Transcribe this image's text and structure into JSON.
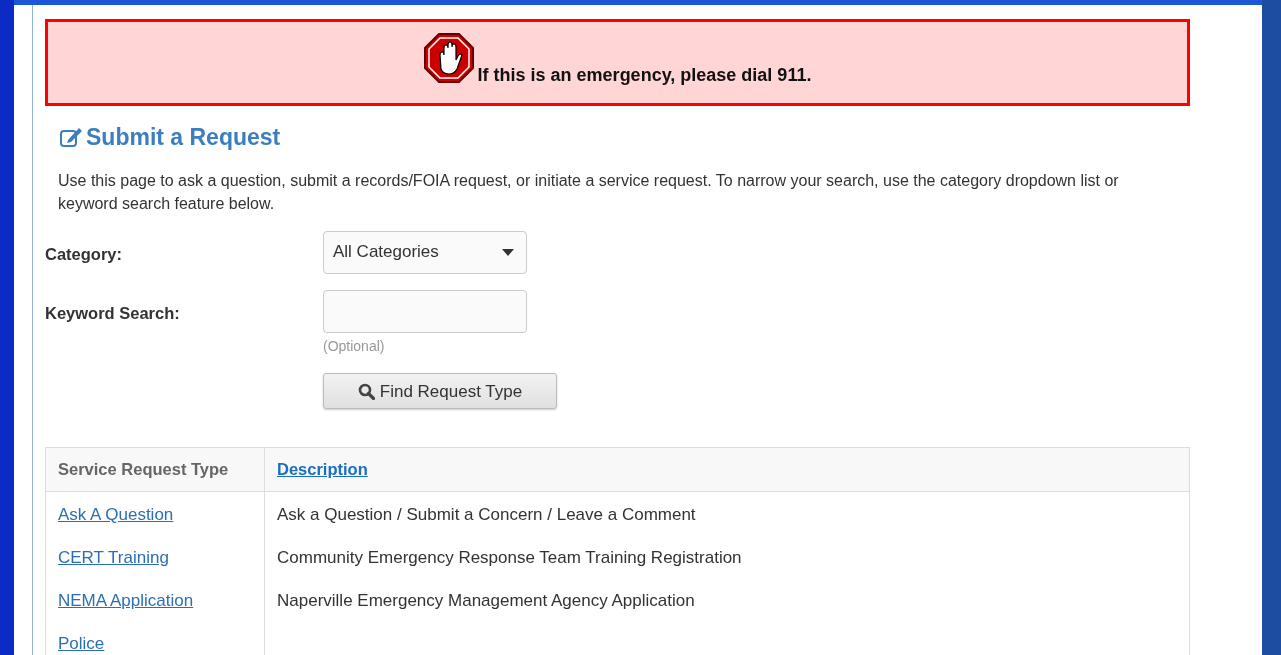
{
  "alert": {
    "text": "If this is an emergency, please dial 911."
  },
  "heading": "Submit a Request",
  "intro": "Use this page to ask a question, submit a records/FOIA request, or initiate a service request. To narrow your search, use the category dropdown list or keyword search feature below.",
  "form": {
    "category": {
      "label": "Category:",
      "value": "All Categories"
    },
    "keyword": {
      "label": "Keyword Search:",
      "hint": "(Optional)"
    },
    "button": "Find Request Type"
  },
  "table": {
    "columns": [
      {
        "label": "Service Request Type",
        "sortable": false
      },
      {
        "label": "Description",
        "sortable": true
      }
    ],
    "rows": [
      {
        "type": "Ask A Question",
        "description": "Ask a Question / Submit a Concern / Leave a Comment"
      },
      {
        "type": "CERT Training",
        "description": "Community Emergency Response Team Training Registration"
      },
      {
        "type": "NEMA Application",
        "description": "Naperville Emergency Management Agency Application"
      },
      {
        "type": "Police"
      }
    ]
  }
}
